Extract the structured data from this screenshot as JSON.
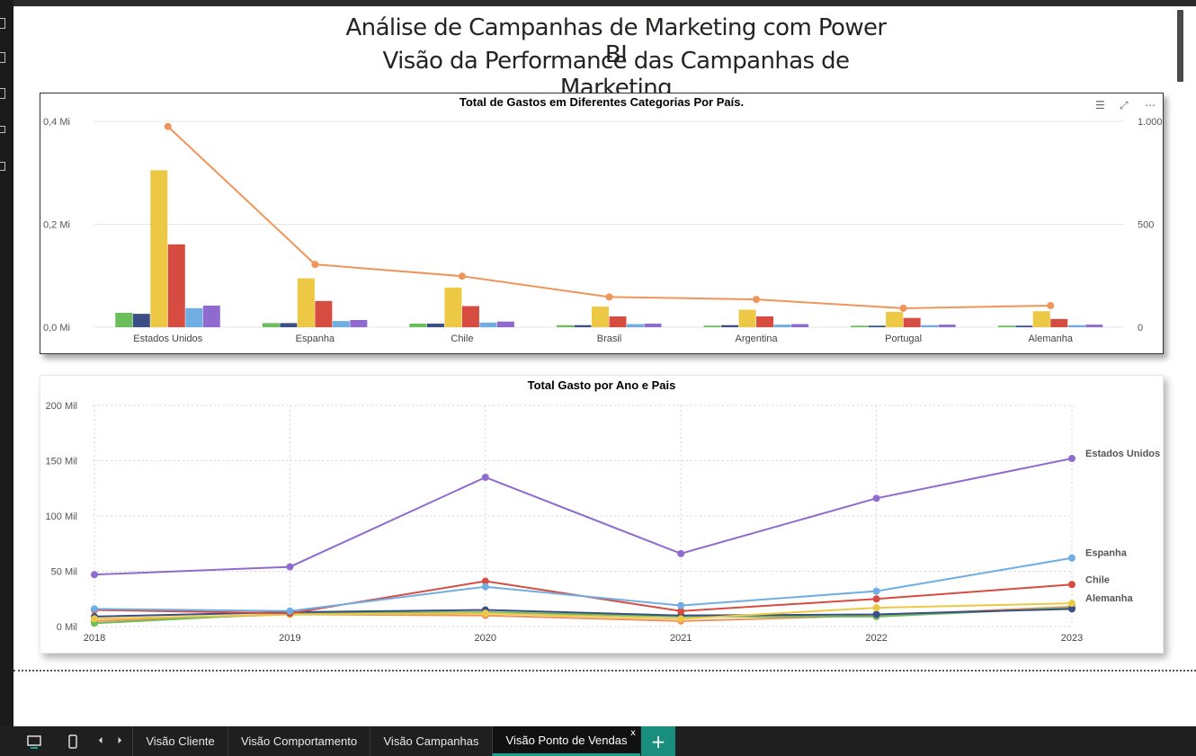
{
  "report": {
    "title_line1": "Análise de Campanhas de Marketing com Power BI",
    "title_line2": "Visão da Performance das Campanhas de Marketing"
  },
  "visual_header_icons": [
    "filter-icon",
    "focus-mode-icon",
    "more-options-icon"
  ],
  "colors": {
    "accent": "#1a9e8c",
    "bar_series": [
      "#6cbd5c",
      "#3b4e86",
      "#ecc845",
      "#d64c41",
      "#6fade3",
      "#8f6bd0"
    ],
    "line_primary": "#f0955a"
  },
  "chart_data": [
    {
      "type": "bar",
      "title": "Total de Gastos em Diferentes Categorias Por País.",
      "categories": [
        "Estados Unidos",
        "Espanha",
        "Chile",
        "Brasil",
        "Argentina",
        "Portugal",
        "Alemanha"
      ],
      "y_ticks": [
        "0,0 Mi",
        "0,2 Mi",
        "0,4 Mi"
      ],
      "ylim": [
        0,
        0.4
      ],
      "y2_ticks": [
        "0",
        "500",
        "1.000"
      ],
      "y2lim": [
        0,
        1000
      ],
      "series": [
        {
          "values": [
            0.028,
            0.008,
            0.007,
            0.004,
            0.003,
            0.003,
            0.003
          ],
          "color": "#6cbd5c"
        },
        {
          "values": [
            0.026,
            0.008,
            0.007,
            0.004,
            0.004,
            0.003,
            0.003
          ],
          "color": "#3b4e86"
        },
        {
          "values": [
            0.305,
            0.095,
            0.077,
            0.04,
            0.034,
            0.03,
            0.031
          ],
          "color": "#ecc845"
        },
        {
          "values": [
            0.161,
            0.051,
            0.041,
            0.021,
            0.021,
            0.018,
            0.016
          ],
          "color": "#d64c41"
        },
        {
          "values": [
            0.037,
            0.012,
            0.009,
            0.006,
            0.005,
            0.004,
            0.004
          ],
          "color": "#6fade3"
        },
        {
          "values": [
            0.042,
            0.014,
            0.011,
            0.007,
            0.006,
            0.005,
            0.005
          ],
          "color": "#8f6bd0"
        }
      ],
      "line_series": {
        "axis": "secondary",
        "values": [
          975,
          305,
          248,
          147,
          135,
          92,
          105
        ],
        "color": "#f0955a"
      }
    },
    {
      "type": "line",
      "title": "Total Gasto por Ano e Pais",
      "x": [
        "2018",
        "2019",
        "2020",
        "2021",
        "2022",
        "2023"
      ],
      "y_ticks": [
        "0 Mil",
        "50 Mil",
        "100 Mil",
        "150 Mil",
        "200 Mil"
      ],
      "ylim": [
        0,
        200
      ],
      "grid": true,
      "series": [
        {
          "name": "Estados Unidos",
          "values": [
            47,
            54,
            135,
            66,
            116,
            152
          ],
          "color": "#8f6bd0"
        },
        {
          "name": "Espanha",
          "values": [
            16,
            14,
            36,
            19,
            32,
            62
          ],
          "color": "#6fade3"
        },
        {
          "name": "Chile",
          "values": [
            15,
            12,
            41,
            14,
            25,
            38
          ],
          "color": "#d64c41"
        },
        {
          "name": "Alemanha",
          "values": [
            7,
            11,
            12,
            7,
            17,
            21
          ],
          "color": "#ecc845"
        },
        {
          "values": [
            9,
            13,
            15,
            10,
            11,
            16
          ],
          "color": "#3b4e86"
        },
        {
          "values": [
            3,
            12,
            13,
            9,
            9,
            17
          ],
          "color": "#6cbd5c"
        },
        {
          "values": [
            5,
            11,
            10,
            5,
            10,
            18
          ],
          "color": "#f0955a"
        }
      ]
    }
  ],
  "bottom_bar": {
    "tabs": [
      "Visão Cliente",
      "Visão Comportamento",
      "Visão Campanhas",
      "Visão Ponto de Vendas"
    ],
    "active_tab": "Visão Ponto de Vendas",
    "close_label": "x",
    "add_label": "+",
    "prev_label": "⏴",
    "next_label": "⏵"
  }
}
